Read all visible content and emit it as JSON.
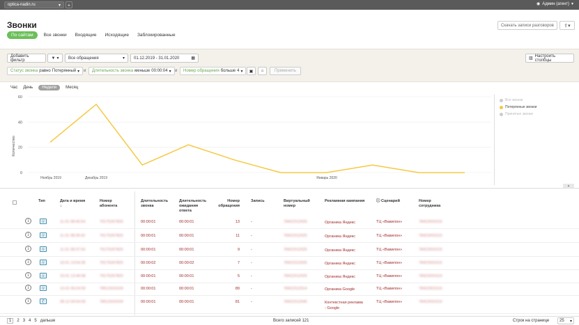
{
  "topbar": {
    "site": "optica-nadin.ru",
    "user": "Админ (агент)"
  },
  "header": {
    "title": "Звонки",
    "download_label": "Скачать записи разговоров"
  },
  "tabs": [
    "По сайтам",
    "Все звонки",
    "Входящие",
    "Исходящие",
    "Заблокированные"
  ],
  "filters": {
    "add_filter": "Добавить фильтр",
    "appeals_select": "Все обращения",
    "date_range": "01.12.2019 - 31.01.2020",
    "configure_columns": "Настроить столбцы",
    "chips": [
      {
        "key": "Статус звонка",
        "op": "равно",
        "value": "Потерянный"
      },
      {
        "key": "Длительность звонка",
        "op": "меньше",
        "value": "00:00:04"
      },
      {
        "key": "Номер обращения",
        "op": "больше",
        "value": "4"
      }
    ],
    "and_text": "и",
    "apply": "Применить"
  },
  "granularity": {
    "items": [
      "Час",
      "День",
      "Неделя",
      "Месяц"
    ],
    "active": "Неделя"
  },
  "chart_data": {
    "type": "line",
    "ylabel": "Количество",
    "ylim": [
      0,
      60
    ],
    "yticks": [
      "0",
      "20",
      "40",
      "60"
    ],
    "xticks": [
      "Ноябрь 2019",
      "Декабрь 2019",
      "Январь 2020"
    ],
    "series": [
      {
        "name": "Все звонки",
        "enabled": false,
        "color": "#cccccc",
        "values": []
      },
      {
        "name": "Потерянные звонки",
        "enabled": true,
        "color": "#f5c842",
        "values": [
          24,
          54,
          6,
          22,
          10,
          0,
          0,
          6,
          0,
          0
        ]
      },
      {
        "name": "Принятые звонки",
        "enabled": false,
        "color": "#cccccc",
        "values": []
      }
    ]
  },
  "table": {
    "headers": [
      "Тип",
      "Дата и время",
      "Номер абонента",
      "Длительность звонка",
      "Длительность ожидания ответа",
      "Номер обращения",
      "Запись",
      "Виртуальный номер",
      "Рекламная кампания",
      "Сценарий",
      "Номер сотрудника"
    ],
    "rows": [
      {
        "type": "in",
        "date": "11.01 08:45:54",
        "phone": "79175267820",
        "dur": "00:00:01",
        "wait": "00:00:01",
        "num": "13",
        "rec": "-",
        "virt": "78422312025",
        "camp": "Органика Яндекс",
        "scen": "ТЦ «Вавилон»",
        "emp": "78422001515"
      },
      {
        "type": "in",
        "date": "11.01 08:39:42",
        "phone": "79175267820",
        "dur": "00:00:01",
        "wait": "00:00:01",
        "num": "11",
        "rec": "-",
        "virt": "78422312025",
        "camp": "Органика Яндекс",
        "scen": "ТЦ «Вавилон»",
        "emp": "78422001515"
      },
      {
        "type": "in",
        "date": "11.01 08:37:03",
        "phone": "79175267820",
        "dur": "00:00:01",
        "wait": "00:00:01",
        "num": "9",
        "rec": "-",
        "virt": "78422312025",
        "camp": "Органика Яндекс",
        "scen": "ТЦ «Вавилон»",
        "emp": "78422001515"
      },
      {
        "type": "in",
        "date": "10.01 13:54:35",
        "phone": "79175267820",
        "dur": "00:00:02",
        "wait": "00:00:02",
        "num": "7",
        "rec": "-",
        "virt": "78422312025",
        "camp": "Органика Яндекс",
        "scen": "ТЦ «Вавилон»",
        "emp": "78422001515"
      },
      {
        "type": "in",
        "date": "10.01 13:49:08",
        "phone": "79175267820",
        "dur": "00:00:01",
        "wait": "00:00:01",
        "num": "5",
        "rec": "-",
        "virt": "78422312025",
        "camp": "Органика Яндекс",
        "scen": "ТЦ «Вавилон»",
        "emp": "78422001515"
      },
      {
        "type": "in",
        "date": "13.01 09:24:59",
        "phone": "78512024159",
        "dur": "00:00:01",
        "wait": "00:00:01",
        "num": "89",
        "rec": "-",
        "virt": "78422312014",
        "camp": "Органика Google",
        "scen": "ТЦ «Вавилон»",
        "emp": "78422001515"
      },
      {
        "type": "out",
        "date": "28.12 09:54:59",
        "phone": "78512024159",
        "dur": "00:00:01",
        "wait": "00:00:01",
        "num": "81",
        "rec": "-",
        "virt": "78422312040",
        "camp": "Контекстная реклама - Google",
        "scen": "ТЦ «Вавилон»",
        "emp": "78422001515"
      }
    ]
  },
  "footer": {
    "pages": [
      "1",
      "2",
      "3",
      "4",
      "5"
    ],
    "more": "дальше",
    "total": "Всего записей 121",
    "rows_label": "Строк на странице",
    "rows_value": "25"
  }
}
